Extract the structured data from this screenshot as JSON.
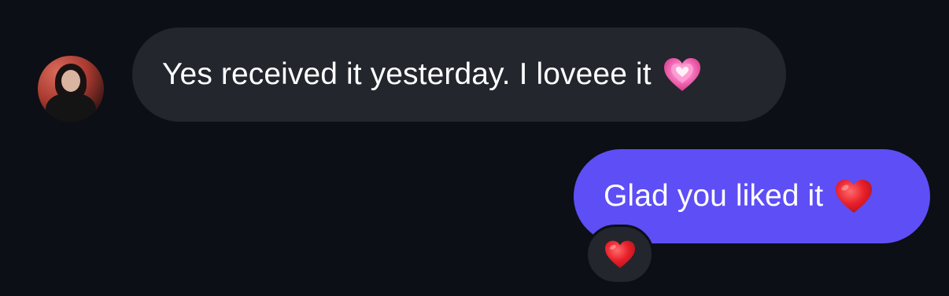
{
  "incoming": {
    "text": "Yes received it yesterday. I loveee it",
    "emoji_icon": "growing-heart-icon",
    "emoji_color": "#f05aa8",
    "bubble_color": "#23262d"
  },
  "outgoing": {
    "text": "Glad you liked it",
    "emoji_icon": "red-heart-icon",
    "emoji_color": "#e8202a",
    "bubble_color": "#5e4ef6"
  },
  "reaction": {
    "emoji_icon": "red-heart-icon",
    "emoji_color": "#e8202a"
  },
  "colors": {
    "background": "#0c0f15"
  }
}
